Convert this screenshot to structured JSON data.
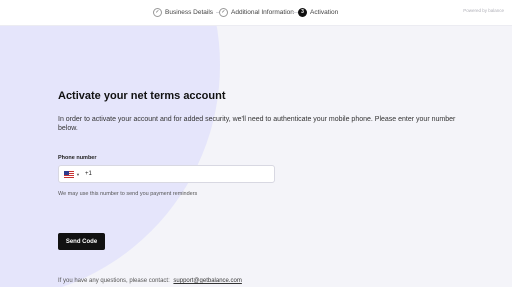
{
  "stepper": {
    "steps": [
      {
        "label": "Business Details",
        "state": "done",
        "icon": "check-icon"
      },
      {
        "label": "Additional Information",
        "state": "done",
        "icon": "check-icon"
      },
      {
        "label": "Activation",
        "state": "active",
        "number": "3"
      }
    ],
    "powered_by": "Powered by balance"
  },
  "main": {
    "title": "Activate your net terms account",
    "description": "In order to activate your account and for added security, we'll need to authenticate your mobile phone. Please enter your number below.",
    "phone": {
      "label": "Phone number",
      "country": "US",
      "flag_icon": "us-flag-icon",
      "dial_code": "+1",
      "value": "",
      "placeholder": ""
    },
    "hint": "We may use this number to send you payment reminders",
    "send_button": "Send Code"
  },
  "footer": {
    "text": "If you have any questions, please contact:",
    "link": "support@getbalance.com"
  },
  "colors": {
    "background": "#f4f4f9",
    "circle": "#e5e5fb",
    "button": "#111111",
    "active_step": "#111111"
  }
}
